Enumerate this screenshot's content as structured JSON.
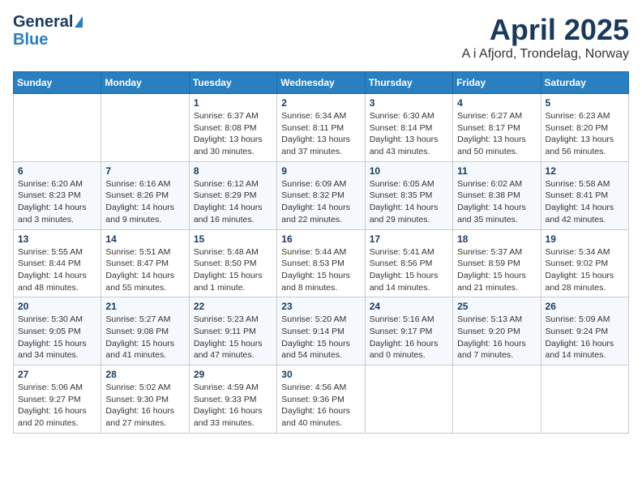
{
  "header": {
    "logo_general": "General",
    "logo_blue": "Blue",
    "title": "April 2025",
    "subtitle": "A i Afjord, Trondelag, Norway"
  },
  "calendar": {
    "days_of_week": [
      "Sunday",
      "Monday",
      "Tuesday",
      "Wednesday",
      "Thursday",
      "Friday",
      "Saturday"
    ],
    "weeks": [
      [
        {
          "day": "",
          "info": ""
        },
        {
          "day": "",
          "info": ""
        },
        {
          "day": "1",
          "info": "Sunrise: 6:37 AM\nSunset: 8:08 PM\nDaylight: 13 hours and 30 minutes."
        },
        {
          "day": "2",
          "info": "Sunrise: 6:34 AM\nSunset: 8:11 PM\nDaylight: 13 hours and 37 minutes."
        },
        {
          "day": "3",
          "info": "Sunrise: 6:30 AM\nSunset: 8:14 PM\nDaylight: 13 hours and 43 minutes."
        },
        {
          "day": "4",
          "info": "Sunrise: 6:27 AM\nSunset: 8:17 PM\nDaylight: 13 hours and 50 minutes."
        },
        {
          "day": "5",
          "info": "Sunrise: 6:23 AM\nSunset: 8:20 PM\nDaylight: 13 hours and 56 minutes."
        }
      ],
      [
        {
          "day": "6",
          "info": "Sunrise: 6:20 AM\nSunset: 8:23 PM\nDaylight: 14 hours and 3 minutes."
        },
        {
          "day": "7",
          "info": "Sunrise: 6:16 AM\nSunset: 8:26 PM\nDaylight: 14 hours and 9 minutes."
        },
        {
          "day": "8",
          "info": "Sunrise: 6:12 AM\nSunset: 8:29 PM\nDaylight: 14 hours and 16 minutes."
        },
        {
          "day": "9",
          "info": "Sunrise: 6:09 AM\nSunset: 8:32 PM\nDaylight: 14 hours and 22 minutes."
        },
        {
          "day": "10",
          "info": "Sunrise: 6:05 AM\nSunset: 8:35 PM\nDaylight: 14 hours and 29 minutes."
        },
        {
          "day": "11",
          "info": "Sunrise: 6:02 AM\nSunset: 8:38 PM\nDaylight: 14 hours and 35 minutes."
        },
        {
          "day": "12",
          "info": "Sunrise: 5:58 AM\nSunset: 8:41 PM\nDaylight: 14 hours and 42 minutes."
        }
      ],
      [
        {
          "day": "13",
          "info": "Sunrise: 5:55 AM\nSunset: 8:44 PM\nDaylight: 14 hours and 48 minutes."
        },
        {
          "day": "14",
          "info": "Sunrise: 5:51 AM\nSunset: 8:47 PM\nDaylight: 14 hours and 55 minutes."
        },
        {
          "day": "15",
          "info": "Sunrise: 5:48 AM\nSunset: 8:50 PM\nDaylight: 15 hours and 1 minute."
        },
        {
          "day": "16",
          "info": "Sunrise: 5:44 AM\nSunset: 8:53 PM\nDaylight: 15 hours and 8 minutes."
        },
        {
          "day": "17",
          "info": "Sunrise: 5:41 AM\nSunset: 8:56 PM\nDaylight: 15 hours and 14 minutes."
        },
        {
          "day": "18",
          "info": "Sunrise: 5:37 AM\nSunset: 8:59 PM\nDaylight: 15 hours and 21 minutes."
        },
        {
          "day": "19",
          "info": "Sunrise: 5:34 AM\nSunset: 9:02 PM\nDaylight: 15 hours and 28 minutes."
        }
      ],
      [
        {
          "day": "20",
          "info": "Sunrise: 5:30 AM\nSunset: 9:05 PM\nDaylight: 15 hours and 34 minutes."
        },
        {
          "day": "21",
          "info": "Sunrise: 5:27 AM\nSunset: 9:08 PM\nDaylight: 15 hours and 41 minutes."
        },
        {
          "day": "22",
          "info": "Sunrise: 5:23 AM\nSunset: 9:11 PM\nDaylight: 15 hours and 47 minutes."
        },
        {
          "day": "23",
          "info": "Sunrise: 5:20 AM\nSunset: 9:14 PM\nDaylight: 15 hours and 54 minutes."
        },
        {
          "day": "24",
          "info": "Sunrise: 5:16 AM\nSunset: 9:17 PM\nDaylight: 16 hours and 0 minutes."
        },
        {
          "day": "25",
          "info": "Sunrise: 5:13 AM\nSunset: 9:20 PM\nDaylight: 16 hours and 7 minutes."
        },
        {
          "day": "26",
          "info": "Sunrise: 5:09 AM\nSunset: 9:24 PM\nDaylight: 16 hours and 14 minutes."
        }
      ],
      [
        {
          "day": "27",
          "info": "Sunrise: 5:06 AM\nSunset: 9:27 PM\nDaylight: 16 hours and 20 minutes."
        },
        {
          "day": "28",
          "info": "Sunrise: 5:02 AM\nSunset: 9:30 PM\nDaylight: 16 hours and 27 minutes."
        },
        {
          "day": "29",
          "info": "Sunrise: 4:59 AM\nSunset: 9:33 PM\nDaylight: 16 hours and 33 minutes."
        },
        {
          "day": "30",
          "info": "Sunrise: 4:56 AM\nSunset: 9:36 PM\nDaylight: 16 hours and 40 minutes."
        },
        {
          "day": "",
          "info": ""
        },
        {
          "day": "",
          "info": ""
        },
        {
          "day": "",
          "info": ""
        }
      ]
    ]
  }
}
